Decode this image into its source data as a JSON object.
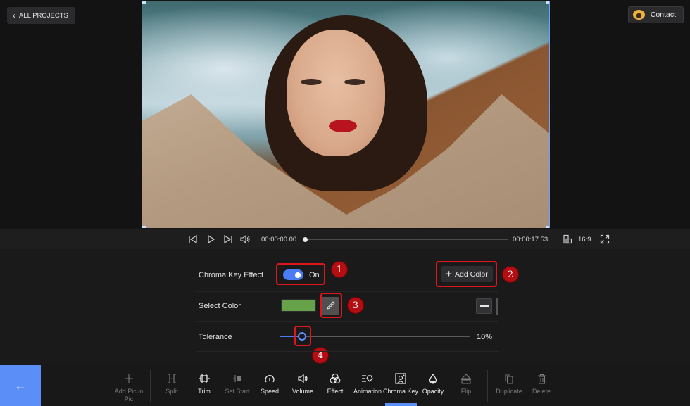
{
  "header": {
    "back_label": "ALL PROJECTS",
    "contact_label": "Contact"
  },
  "playback": {
    "current_time": "00:00:00.00",
    "total_time": "00:00:17.53",
    "aspect_ratio": "16:9",
    "progress": 0.0,
    "icons": [
      "skip-back-icon",
      "play-icon",
      "skip-forward-icon",
      "volume-icon",
      "aspect-ratio-icon",
      "fullscreen-icon"
    ]
  },
  "chroma_panel": {
    "effect_label": "Chroma Key Effect",
    "effect_state": "On",
    "effect_enabled": true,
    "add_color_label": "Add Color",
    "select_color_label": "Select Color",
    "selected_color": "#66a24a",
    "tolerance_label": "Tolerance",
    "tolerance_value": "10%",
    "tolerance_percent": 10
  },
  "annotations": [
    "1",
    "2",
    "3",
    "4"
  ],
  "toolbar": {
    "items": [
      {
        "label": "Add Pic in Pic",
        "icon": "plus-icon",
        "enabled": false
      },
      {
        "label": "Split",
        "icon": "split-icon",
        "enabled": false
      },
      {
        "label": "Trim",
        "icon": "trim-icon",
        "enabled": true
      },
      {
        "label": "Set Start",
        "icon": "set-start-icon",
        "enabled": false
      },
      {
        "label": "Speed",
        "icon": "speedometer-icon",
        "enabled": true
      },
      {
        "label": "Volume",
        "icon": "volume-icon",
        "enabled": true
      },
      {
        "label": "Effect",
        "icon": "effect-icon",
        "enabled": true
      },
      {
        "label": "Animation",
        "icon": "animation-icon",
        "enabled": true
      },
      {
        "label": "Chroma Key",
        "icon": "chroma-key-icon",
        "enabled": true,
        "active": true
      },
      {
        "label": "Opacity",
        "icon": "droplet-icon",
        "enabled": true
      },
      {
        "label": "Flip",
        "icon": "flip-icon",
        "enabled": false
      },
      {
        "label": "Duplicate",
        "icon": "duplicate-icon",
        "enabled": false
      },
      {
        "label": "Delete",
        "icon": "trash-icon",
        "enabled": false
      }
    ]
  },
  "colors": {
    "accent": "#5b8ef7",
    "annotation_red": "#e0161f"
  }
}
